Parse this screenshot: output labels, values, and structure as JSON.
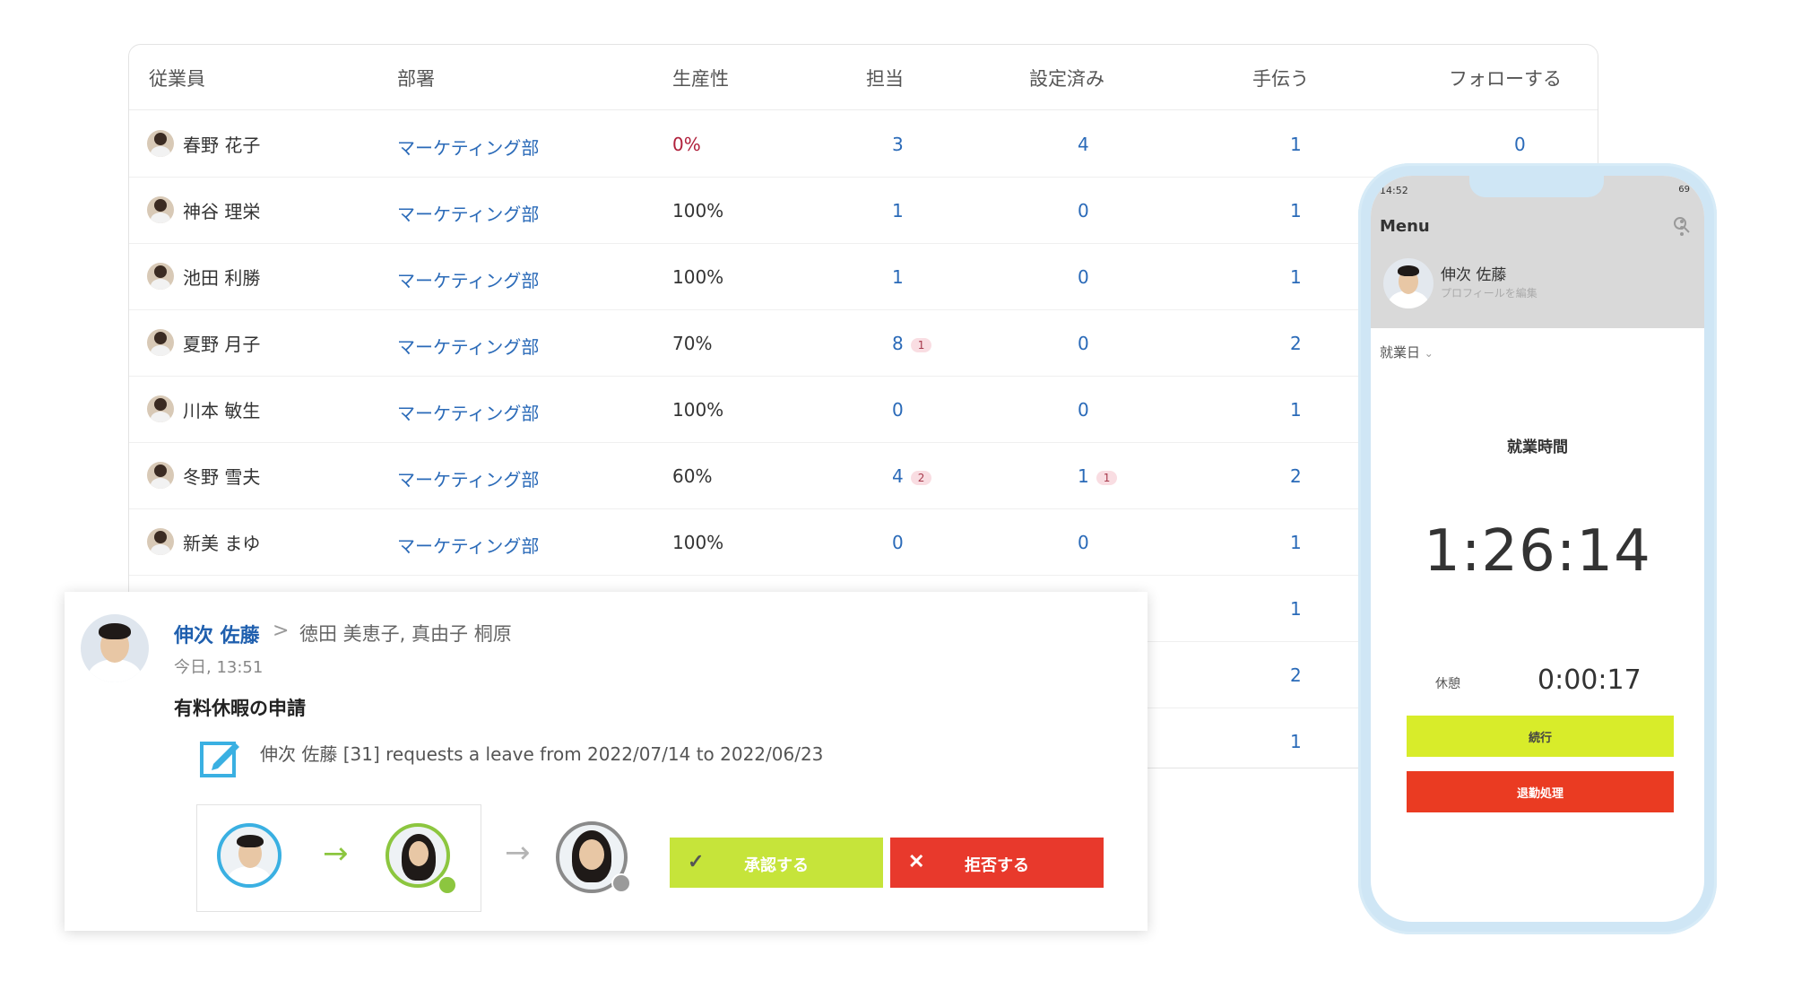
{
  "table": {
    "headers": [
      "従業員",
      "部署",
      "生産性",
      "担当",
      "設定済み",
      "手伝う",
      "フォローする"
    ],
    "rows": [
      {
        "name": "春野 花子",
        "dept": "マーケティング部",
        "productivity": "0%",
        "assigned": "3",
        "assigned_badge": "",
        "set": "4",
        "set_badge": "",
        "help": "1",
        "follow": "0"
      },
      {
        "name": "神谷 理栄",
        "dept": "マーケティング部",
        "productivity": "100%",
        "assigned": "1",
        "assigned_badge": "",
        "set": "0",
        "set_badge": "",
        "help": "1",
        "follow": ""
      },
      {
        "name": "池田 利勝",
        "dept": "マーケティング部",
        "productivity": "100%",
        "assigned": "1",
        "assigned_badge": "",
        "set": "0",
        "set_badge": "",
        "help": "1",
        "follow": ""
      },
      {
        "name": "夏野 月子",
        "dept": "マーケティング部",
        "productivity": "70%",
        "assigned": "8",
        "assigned_badge": "1",
        "set": "0",
        "set_badge": "",
        "help": "2",
        "follow": ""
      },
      {
        "name": "川本 敏生",
        "dept": "マーケティング部",
        "productivity": "100%",
        "assigned": "0",
        "assigned_badge": "",
        "set": "0",
        "set_badge": "",
        "help": "1",
        "follow": ""
      },
      {
        "name": "冬野 雪夫",
        "dept": "マーケティング部",
        "productivity": "60%",
        "assigned": "4",
        "assigned_badge": "2",
        "set": "1",
        "set_badge": "1",
        "help": "2",
        "follow": ""
      },
      {
        "name": "新美 まゆ",
        "dept": "マーケティング部",
        "productivity": "100%",
        "assigned": "0",
        "assigned_badge": "",
        "set": "0",
        "set_badge": "",
        "help": "1",
        "follow": ""
      },
      {
        "name": "",
        "dept": "",
        "productivity": "",
        "assigned": "",
        "assigned_badge": "",
        "set": "",
        "set_badge": "",
        "help": "1",
        "follow": ""
      },
      {
        "name": "",
        "dept": "",
        "productivity": "",
        "assigned": "",
        "assigned_badge": "",
        "set": "",
        "set_badge": "",
        "help": "2",
        "follow": ""
      },
      {
        "name": "",
        "dept": "",
        "productivity": "",
        "assigned": "",
        "assigned_badge": "",
        "set": "",
        "set_badge": "",
        "help": "1",
        "follow": ""
      }
    ]
  },
  "request": {
    "from": "伸次 佐藤",
    "separator": ">",
    "to": "徳田 美恵子, 真由子 桐原",
    "time": "今日, 13:51",
    "title": "有料休暇の申請",
    "text": "伸次 佐藤 [31] requests a leave from 2022/07/14 to 2022/06/23",
    "approve_label": "承認する",
    "reject_label": "拒否する",
    "approve_icon": "✓",
    "reject_icon": "✕",
    "flow_arrow": "→"
  },
  "phone": {
    "status_time": "14:52",
    "status_battery": "69",
    "menu_label": "Menu",
    "user_name": "伸次 佐藤",
    "user_sub": "プロフィールを編集",
    "dropdown_label": "就業日",
    "work_title": "就業時間",
    "timer": "1:26:14",
    "break_label": "休憩",
    "break_time": "0:00:17",
    "continue_label": "続行",
    "leave_label": "退勤処理"
  },
  "colors": {
    "link_blue": "#2a6ab8",
    "zero_red": "#b0203b",
    "approve_green": "#c6e43a",
    "reject_red": "#e8392c",
    "phone_frame": "#cfe6f5"
  }
}
